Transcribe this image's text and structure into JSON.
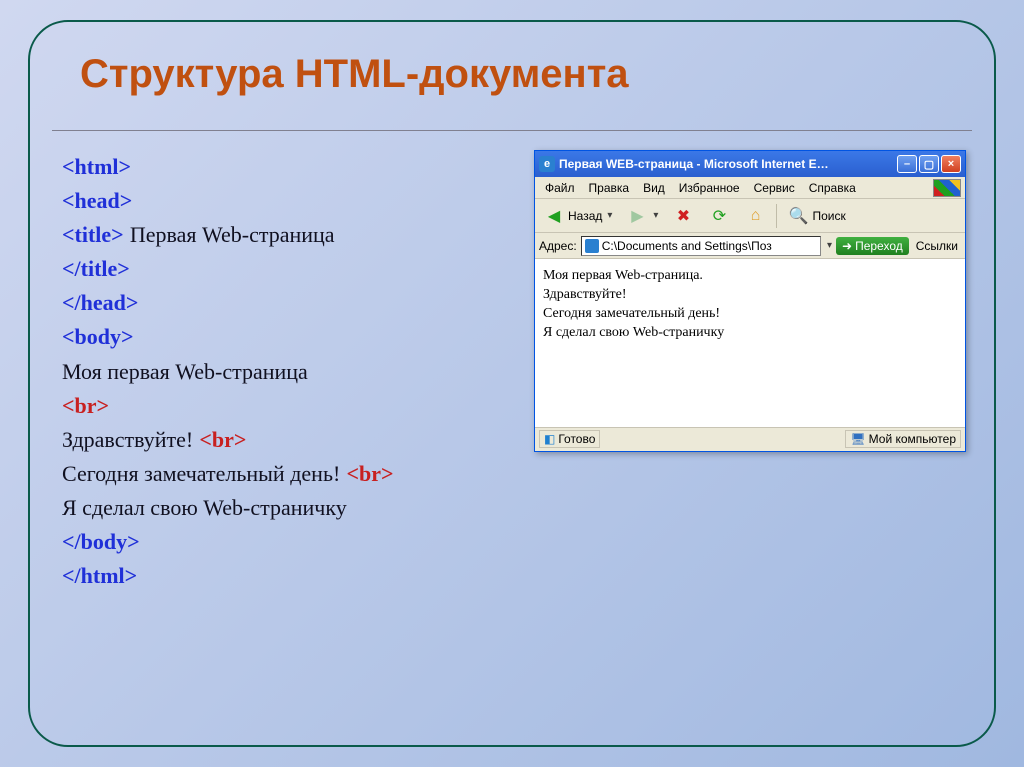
{
  "slide": {
    "title": "Структура HTML-документа"
  },
  "code": {
    "html_open": "<html>",
    "head_open": "<head>",
    "title_open": "<title>",
    "title_text": "Первая  Web-страница",
    "title_close": "</title>",
    "head_close": "</head>",
    "body_open": "<body>",
    "line1": "Моя первая Web-страница",
    "br": "<br>",
    "line2": "Здравствуйте!",
    "line3": "Сегодня замечательный день!",
    "line4": "Я сделал свою Web-страничку",
    "body_close": "</body>",
    "html_close": "</html>"
  },
  "browser": {
    "title": "Первая WEB-страница - Microsoft Internet E…",
    "menu": {
      "file": "Файл",
      "edit": "Правка",
      "view": "Вид",
      "favorites": "Избранное",
      "tools": "Сервис",
      "help": "Справка"
    },
    "toolbar": {
      "back": "Назад",
      "search": "Поиск"
    },
    "address_label": "Адрес:",
    "address_value": "C:\\Documents and Settings\\Поз",
    "go": "Переход",
    "links": "Ссылки",
    "page": {
      "l1": "Моя первая Web-страница.",
      "l2": "Здравствуйте!",
      "l3": "Сегодня замечательный день!",
      "l4": "Я сделал свою Web-страничку"
    },
    "status_done": "Готово",
    "status_zone": "Мой компьютер"
  }
}
